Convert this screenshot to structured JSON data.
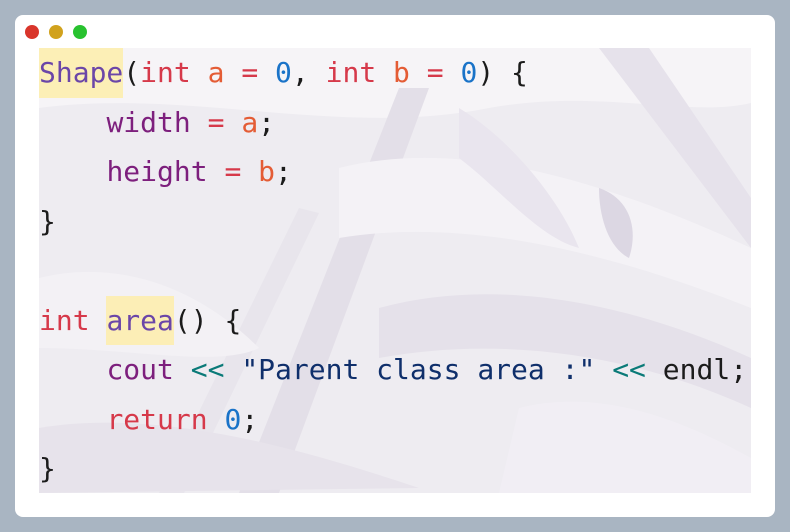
{
  "window": {
    "traffic_lights": [
      {
        "name": "close",
        "color": "#d9352b"
      },
      {
        "name": "minimize",
        "color": "#d1a21d"
      },
      {
        "name": "zoom",
        "color": "#28c22f"
      }
    ]
  },
  "code": {
    "language": "cpp",
    "lines": [
      {
        "tokens": [
          {
            "t": "Shape",
            "c": "fn",
            "hl": true
          },
          {
            "t": "(",
            "c": "plain"
          },
          {
            "t": "int",
            "c": "kw"
          },
          {
            "t": " ",
            "c": "plain"
          },
          {
            "t": "a",
            "c": "pm"
          },
          {
            "t": " ",
            "c": "plain"
          },
          {
            "t": "=",
            "c": "op"
          },
          {
            "t": " ",
            "c": "plain"
          },
          {
            "t": "0",
            "c": "num"
          },
          {
            "t": ", ",
            "c": "plain"
          },
          {
            "t": "int",
            "c": "kw"
          },
          {
            "t": " ",
            "c": "plain"
          },
          {
            "t": "b",
            "c": "pm"
          },
          {
            "t": " ",
            "c": "plain"
          },
          {
            "t": "=",
            "c": "op"
          },
          {
            "t": " ",
            "c": "plain"
          },
          {
            "t": "0",
            "c": "num"
          },
          {
            "t": ") {",
            "c": "plain"
          }
        ]
      },
      {
        "tokens": [
          {
            "t": "    ",
            "c": "plain"
          },
          {
            "t": "width",
            "c": "mem"
          },
          {
            "t": " ",
            "c": "plain"
          },
          {
            "t": "=",
            "c": "op"
          },
          {
            "t": " ",
            "c": "plain"
          },
          {
            "t": "a",
            "c": "pm"
          },
          {
            "t": ";",
            "c": "plain"
          }
        ]
      },
      {
        "tokens": [
          {
            "t": "    ",
            "c": "plain"
          },
          {
            "t": "height",
            "c": "mem"
          },
          {
            "t": " ",
            "c": "plain"
          },
          {
            "t": "=",
            "c": "op"
          },
          {
            "t": " ",
            "c": "plain"
          },
          {
            "t": "b",
            "c": "pm"
          },
          {
            "t": ";",
            "c": "plain"
          }
        ]
      },
      {
        "tokens": [
          {
            "t": "}",
            "c": "plain"
          }
        ]
      },
      {
        "tokens": []
      },
      {
        "tokens": [
          {
            "t": "int",
            "c": "kw"
          },
          {
            "t": " ",
            "c": "plain"
          },
          {
            "t": "area",
            "c": "fn",
            "hl": true
          },
          {
            "t": "() {",
            "c": "plain"
          }
        ]
      },
      {
        "tokens": [
          {
            "t": "    ",
            "c": "plain"
          },
          {
            "t": "cout",
            "c": "mem"
          },
          {
            "t": " ",
            "c": "plain"
          },
          {
            "t": "<<",
            "c": "strm"
          },
          {
            "t": " ",
            "c": "plain"
          },
          {
            "t": "\"Parent class area :\"",
            "c": "str"
          },
          {
            "t": " ",
            "c": "plain"
          },
          {
            "t": "<<",
            "c": "strm"
          },
          {
            "t": " endl;",
            "c": "plain"
          }
        ]
      },
      {
        "tokens": [
          {
            "t": "    ",
            "c": "plain"
          },
          {
            "t": "return",
            "c": "kw"
          },
          {
            "t": " ",
            "c": "plain"
          },
          {
            "t": "0",
            "c": "num"
          },
          {
            "t": ";",
            "c": "plain"
          }
        ]
      },
      {
        "tokens": [
          {
            "t": "}",
            "c": "plain"
          }
        ]
      }
    ]
  },
  "colors": {
    "page_background": "#a9b5c2",
    "window_background": "#ffffff",
    "keyword": "#d6394a",
    "function": "#6b46a8",
    "parameter": "#e45c35",
    "number": "#1a73c8",
    "member": "#7d1f7d",
    "string": "#0f2f6b",
    "stream_operator": "#0a7a78",
    "highlight": "#fdedaa"
  }
}
